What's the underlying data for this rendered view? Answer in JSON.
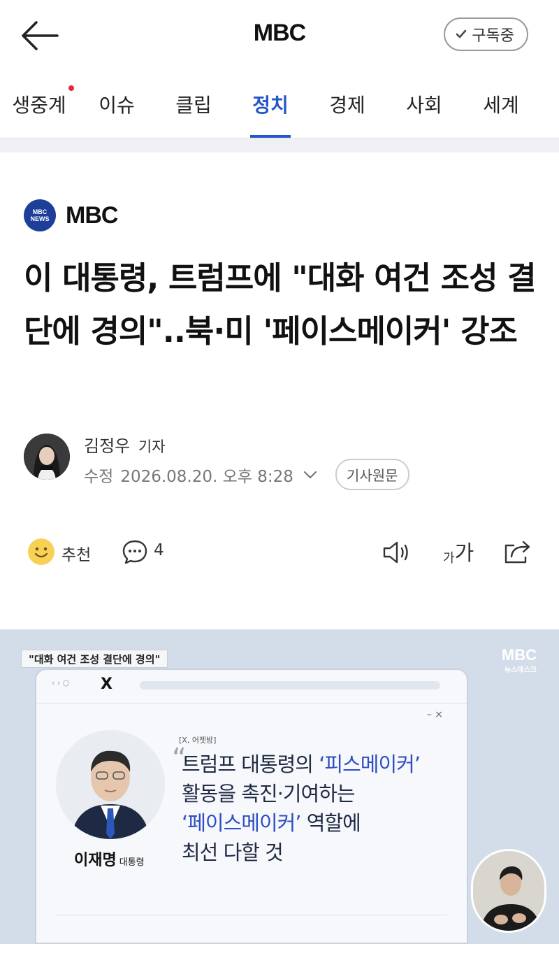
{
  "app": {
    "title": "MBC",
    "subscribe_label": "구독중"
  },
  "tabs": [
    {
      "label": "생중계",
      "live": true
    },
    {
      "label": "이슈"
    },
    {
      "label": "클립"
    },
    {
      "label": "정치",
      "active": true
    },
    {
      "label": "경제"
    },
    {
      "label": "사회"
    },
    {
      "label": "세계"
    }
  ],
  "press": {
    "name": "MBC",
    "logo_line1": "MBC",
    "logo_line2": "NEWS"
  },
  "article": {
    "headline": "이 대통령, 트럼프에 \"대화 여건 조성 결단에 경의\"..북·미 '페이스메이커' 강조",
    "reporter": "김정우",
    "reporter_role": "기자",
    "updated_label": "수정",
    "updated_at": "2026.08.20. 오후 8:28",
    "origin_button": "기사원문"
  },
  "actions": {
    "recommend_label": "추천",
    "comment_count": "4",
    "font_small": "가",
    "font_big": "가"
  },
  "image": {
    "caption_tag": "\"대화 여건 조성 결단에 경의\"",
    "watermark": "MBC",
    "watermark_sub": "뉴스데스크",
    "browser_logo": "X",
    "source_label": "[X, 어젯밤]",
    "quote_line1_a": "트럼프 대통령의 ",
    "quote_line1_b": "‘피스메이커’",
    "quote_line2": "활동을 촉진·기여하는",
    "quote_line3_a": "‘페이스메이커’",
    "quote_line3_b": " 역할에",
    "quote_line4": "최선 다할 것",
    "politician_name": "이재명",
    "politician_title": "대통령"
  },
  "colors": {
    "accent": "#2456c9",
    "live_dot": "#e6283b",
    "press_logo": "#1d3f9a"
  }
}
